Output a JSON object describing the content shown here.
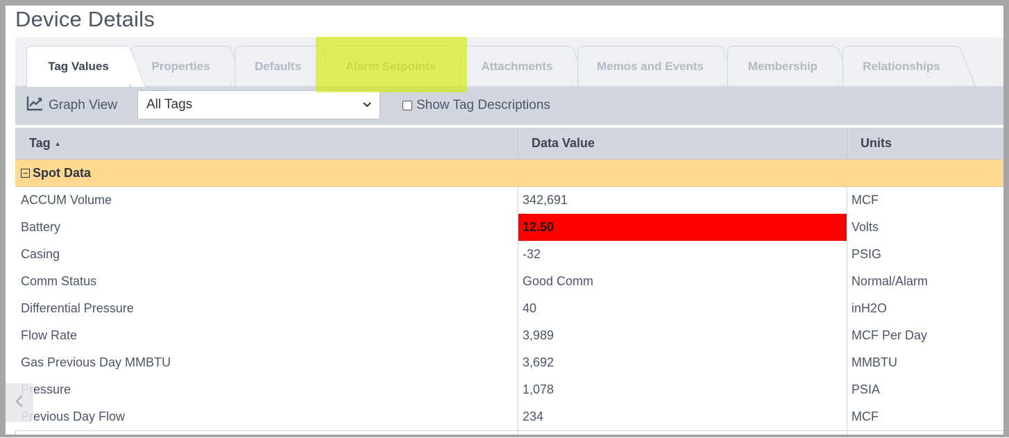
{
  "page": {
    "title": "Device Details"
  },
  "tabs": [
    {
      "label": "Tag Values",
      "active": true
    },
    {
      "label": "Properties"
    },
    {
      "label": "Defaults"
    },
    {
      "label": "Alarm Setpoints"
    },
    {
      "label": "Attachments"
    },
    {
      "label": "Memos and Events"
    },
    {
      "label": "Membership"
    },
    {
      "label": "Relationships"
    }
  ],
  "toolbar": {
    "graph_view_label": "Graph View",
    "graph_icon": "line-chart-icon",
    "filter_value": "All Tags",
    "show_descriptions_label": "Show Tag Descriptions",
    "show_descriptions_checked": false
  },
  "grid": {
    "columns": {
      "tag": "Tag",
      "tag_sort": "▲",
      "value": "Data Value",
      "units": "Units"
    },
    "group": {
      "label": "Spot Data",
      "expanded": true
    },
    "rows": [
      {
        "tag": "ACCUM Volume",
        "value": "342,691",
        "units": "MCF"
      },
      {
        "tag": "Battery",
        "value": "12.50",
        "units": "Volts",
        "alarm": true
      },
      {
        "tag": "Casing",
        "value": "-32",
        "units": "PSIG"
      },
      {
        "tag": "Comm Status",
        "value": "Good Comm",
        "units": "Normal/Alarm"
      },
      {
        "tag": "Differential Pressure",
        "value": "40",
        "units": "inH2O"
      },
      {
        "tag": "Flow Rate",
        "value": "3,989",
        "units": "MCF Per Day"
      },
      {
        "tag": "Gas Previous Day MMBTU",
        "value": "3,692",
        "units": "MMBTU"
      },
      {
        "tag": "Pressure",
        "value": "1,078",
        "units": "PSIA"
      },
      {
        "tag": "Previous Day Flow",
        "value": "234",
        "units": "MCF"
      }
    ]
  },
  "colors": {
    "alarm": "#ff0000",
    "group_row": "#fdd991",
    "highlight": "#d4ec00",
    "header": "#d2d7df"
  },
  "scroll_icon": "chevron-left-icon"
}
